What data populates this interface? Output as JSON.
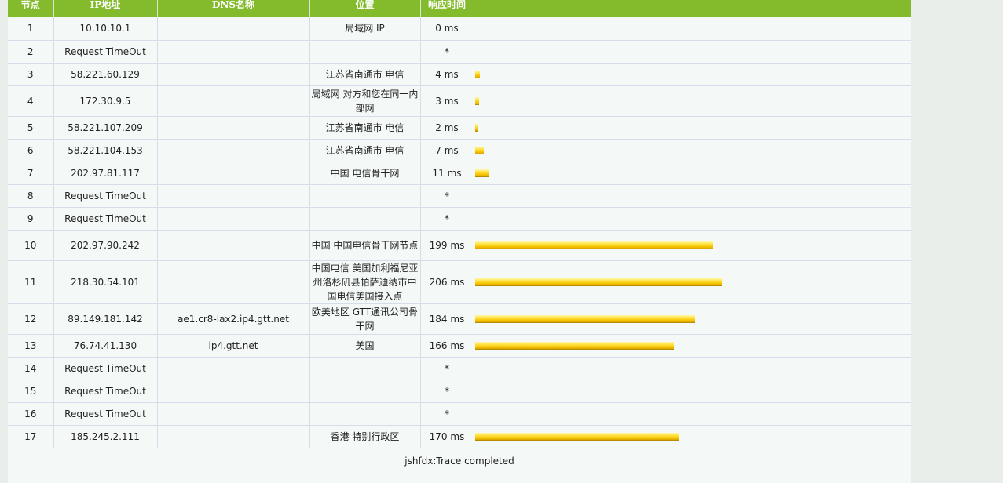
{
  "table": {
    "headers": {
      "hop": "节点",
      "ip": "IP地址",
      "dns": "DNS名称",
      "location": "位置",
      "response": "响应时间"
    },
    "rows": [
      {
        "hop": "1",
        "ip": "10.10.10.1",
        "dns": "",
        "location": "局域网 IP",
        "time": "0 ms",
        "ms": 0
      },
      {
        "hop": "2",
        "ip": "Request TimeOut",
        "dns": "",
        "location": "",
        "time": "*",
        "ms": null
      },
      {
        "hop": "3",
        "ip": "58.221.60.129",
        "dns": "",
        "location": "江苏省南通市 电信",
        "time": "4 ms",
        "ms": 4
      },
      {
        "hop": "4",
        "ip": "172.30.9.5",
        "dns": "",
        "location": "局域网 对方和您在同一内部网",
        "time": "3 ms",
        "ms": 3
      },
      {
        "hop": "5",
        "ip": "58.221.107.209",
        "dns": "",
        "location": "江苏省南通市 电信",
        "time": "2 ms",
        "ms": 2
      },
      {
        "hop": "6",
        "ip": "58.221.104.153",
        "dns": "",
        "location": "江苏省南通市 电信",
        "time": "7 ms",
        "ms": 7
      },
      {
        "hop": "7",
        "ip": "202.97.81.117",
        "dns": "",
        "location": "中国 电信骨干网",
        "time": "11 ms",
        "ms": 11
      },
      {
        "hop": "8",
        "ip": "Request TimeOut",
        "dns": "",
        "location": "",
        "time": "*",
        "ms": null
      },
      {
        "hop": "9",
        "ip": "Request TimeOut",
        "dns": "",
        "location": "",
        "time": "*",
        "ms": null
      },
      {
        "hop": "10",
        "ip": "202.97.90.242",
        "dns": "",
        "location": "中国 中国电信骨干网节点",
        "time": "199 ms",
        "ms": 199
      },
      {
        "hop": "11",
        "ip": "218.30.54.101",
        "dns": "",
        "location": "中国电信 美国加利福尼亚州洛杉矶县帕萨迪纳市中国电信美国接入点",
        "time": "206 ms",
        "ms": 206
      },
      {
        "hop": "12",
        "ip": "89.149.181.142",
        "dns": "ae1.cr8-lax2.ip4.gtt.net",
        "location": "欧美地区 GTT通讯公司骨干网",
        "time": "184 ms",
        "ms": 184
      },
      {
        "hop": "13",
        "ip": "76.74.41.130",
        "dns": "ip4.gtt.net",
        "location": "美国",
        "time": "166 ms",
        "ms": 166
      },
      {
        "hop": "14",
        "ip": "Request TimeOut",
        "dns": "",
        "location": "",
        "time": "*",
        "ms": null
      },
      {
        "hop": "15",
        "ip": "Request TimeOut",
        "dns": "",
        "location": "",
        "time": "*",
        "ms": null
      },
      {
        "hop": "16",
        "ip": "Request TimeOut",
        "dns": "",
        "location": "",
        "time": "*",
        "ms": null
      },
      {
        "hop": "17",
        "ip": "185.245.2.111",
        "dns": "",
        "location": "香港 特别行政区",
        "time": "170 ms",
        "ms": 170
      }
    ]
  },
  "status": "jshfdx:Trace completed",
  "colors": {
    "header_bg": "#83bb2d",
    "bar": "#f5c200",
    "panel_bg": "#f4f9f8"
  }
}
